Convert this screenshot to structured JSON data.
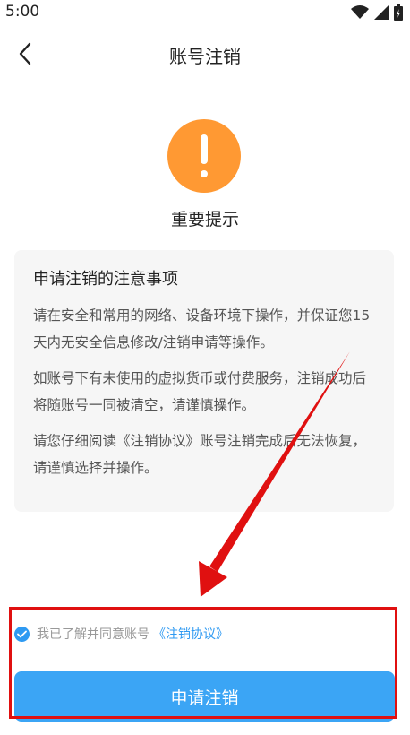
{
  "status_bar": {
    "time": "5:00",
    "icons": [
      "wifi-icon",
      "signal-icon",
      "battery-icon"
    ]
  },
  "nav": {
    "back_icon": "chevron-left-icon",
    "title": "账号注销"
  },
  "warning": {
    "icon": "exclamation-icon",
    "icon_color": "#ff9933",
    "title": "重要提示"
  },
  "notice": {
    "heading": "申请注销的注意事项",
    "paragraphs": [
      "请在安全和常用的网络、设备环境下操作，并保证您15天内无安全信息修改/注销申请等操作。",
      "如账号下有未使用的虚拟货币或付费服务，注销成功后将随账号一同被清空，请谨慎操作。",
      "请您仔细阅读《注销协议》账号注销完成后无法恢复，请谨慎选择并操作。"
    ]
  },
  "agreement": {
    "checked": true,
    "text": "我已了解并同意账号",
    "link": "《注销协议》"
  },
  "apply_button": {
    "label": "申请注销"
  },
  "colors": {
    "accent": "#3ba5f5",
    "link": "#2f9af2",
    "annotation": "#e01010"
  }
}
